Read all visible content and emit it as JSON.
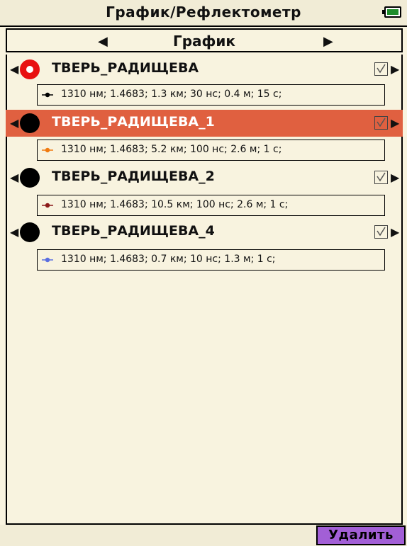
{
  "header": {
    "title": "График/Рефлектометр",
    "battery_icon": "battery-icon"
  },
  "nav": {
    "left_arrow": "◀",
    "label": "График",
    "right_arrow": "▶"
  },
  "traces": [
    {
      "name": "ТВЕРЬ_РАДИЩЕВА",
      "params": "1310 нм; 1.4683; 1.3 км; 30 нс; 0.4 м; 15 с;",
      "marker_color": "#000000",
      "dot_color": "#e81010",
      "active": true,
      "checked": true,
      "selected": false
    },
    {
      "name": "ТВЕРЬ_РАДИЩЕВА_1",
      "params": "1310 нм; 1.4683; 5.2 км; 100 нс; 2.6 м; 1 с;",
      "marker_color": "#f07a10",
      "dot_color": "#000000",
      "active": false,
      "checked": true,
      "selected": true
    },
    {
      "name": "ТВЕРЬ_РАДИЩЕВА_2",
      "params": "1310 нм; 1.4683; 10.5 км; 100 нс; 2.6 м; 1 с;",
      "marker_color": "#8b1a1a",
      "dot_color": "#000000",
      "active": false,
      "checked": true,
      "selected": false
    },
    {
      "name": "ТВЕРЬ_РАДИЩЕВА_4",
      "params": "1310 нм; 1.4683; 0.7 км; 10 нс; 1.3 м; 1 с;",
      "marker_color": "#5a6ee0",
      "dot_color": "#000000",
      "active": false,
      "checked": true,
      "selected": false
    }
  ],
  "row_arrows": {
    "left": "◀",
    "right": "▶"
  },
  "footer": {
    "delete_label": "Удалить"
  },
  "colors": {
    "background": "#f8f3df",
    "selected_row": "#e06040",
    "delete_button": "#a25fd6",
    "battery_fill": "#1e8c2a"
  }
}
